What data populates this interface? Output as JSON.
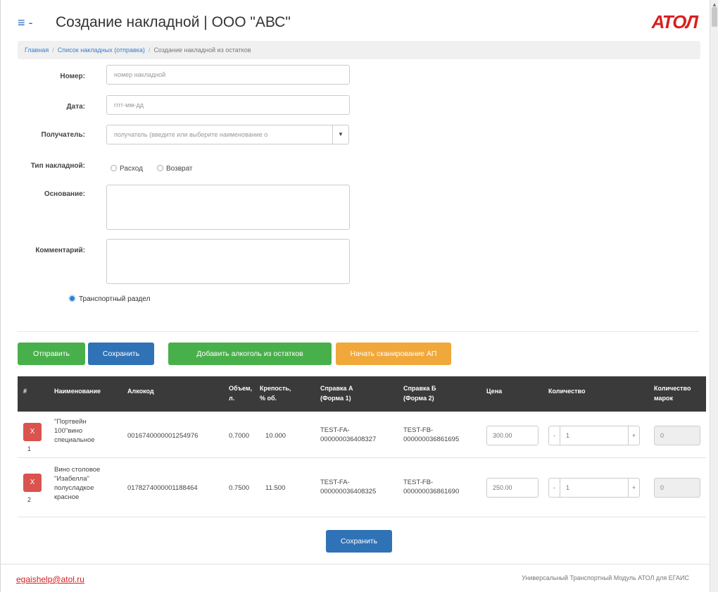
{
  "header": {
    "menu_icon": "menu-icon",
    "menu_glyph": "≡ -",
    "title": "Создание накладной | ООО \"АВС\"",
    "logo": "АТОЛ"
  },
  "breadcrumb": {
    "items": [
      "Главная",
      "Список накладных (отправка)",
      "Создание накладной из остатков"
    ]
  },
  "form": {
    "number_label": "Номер:",
    "number_placeholder": "номер накладной",
    "date_label": "Дата:",
    "date_placeholder": "гггг-мм-дд",
    "recipient_label": "Получатель:",
    "recipient_placeholder": "получатель (введите или выберите наименование о",
    "type_label": "Тип накладной:",
    "type_options": [
      "Расход",
      "Возврат"
    ],
    "basis_label": "Основание:",
    "comment_label": "Комментарий:",
    "transport_label": "Транспортный раздел"
  },
  "actions": {
    "send": "Отправить",
    "save": "Сохранить",
    "add_from_stock": "Добавить алкоголь из остатков",
    "start_scan": "Начать сканирование АП"
  },
  "table": {
    "columns": [
      "#",
      "Наименование",
      "Алкокод",
      "Объем, л.",
      "Крепость, % об.",
      "Справка А (Форма 1)",
      "Справка Б (Форма 2)",
      "Цена",
      "Количество",
      "Количество марок"
    ],
    "rows": [
      {
        "num": "1",
        "delete": "X",
        "name": "\"Портвейн 100\"вино специальное",
        "alcocode": "0016740000001254976",
        "volume": "0.7000",
        "strength": "10.000",
        "ref_a": "TEST-FA-000000036408327",
        "ref_b": "TEST-FB-000000036861695",
        "price": "300.00",
        "qty_minus": "-",
        "qty": "1",
        "qty_plus": "+",
        "marks": "0"
      },
      {
        "num": "2",
        "delete": "X",
        "name": "Вино столовое \"Изабелла\" полусладкое красное",
        "alcocode": "0178274000001188464",
        "volume": "0.7500",
        "strength": "11.500",
        "ref_a": "TEST-FA-000000036408325",
        "ref_b": "TEST-FB-000000036861690",
        "price": "250.00",
        "qty_minus": "-",
        "qty": "1",
        "qty_plus": "+",
        "marks": "0"
      }
    ]
  },
  "bottom_save": "Сохранить",
  "footer": {
    "email": "egaishelp@atol.ru",
    "product": "Универсальный Транспортный Модуль АТОЛ для ЕГАИС"
  },
  "colors": {
    "accent_blue": "#2f72b6",
    "green": "#48b04a",
    "orange": "#f0a83a",
    "danger": "#d9534f",
    "brand_red": "#d92020",
    "table_header": "#3a3a3a"
  }
}
